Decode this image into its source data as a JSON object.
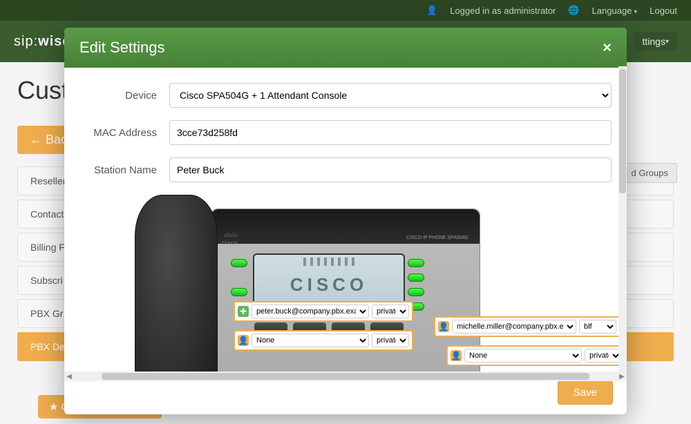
{
  "topbar": {
    "logged_in": "Logged in as administrator",
    "language": "Language",
    "logout": "Logout"
  },
  "nav": {
    "logo_left": "sip",
    "logo_right": "wise",
    "settings_menu": "ttings"
  },
  "page": {
    "title_truncated": "Cust",
    "back": "Back",
    "right_pill": "d Groups",
    "create_btn": "Create PBX Device"
  },
  "sidebar": {
    "items": [
      {
        "label": "Reseller"
      },
      {
        "label": "Contact"
      },
      {
        "label": "Billing F"
      },
      {
        "label": "Subscri"
      },
      {
        "label": "PBX Gr"
      },
      {
        "label": "PBX De"
      }
    ]
  },
  "modal": {
    "title": "Edit Settings",
    "save": "Save",
    "fields": {
      "device_label": "Device",
      "device_value": "Cisco SPA504G + 1 Attendant Console",
      "mac_label": "MAC Address",
      "mac_value": "3cce73d258fd",
      "station_label": "Station Name",
      "station_value": "Peter Buck"
    },
    "phone": {
      "brand_small": "cisco",
      "brand_bars": "ıılıılıı",
      "top_right": "CISCO IP PHONE\nSPA504G",
      "screen_text": "CISCO"
    },
    "linekeys": [
      {
        "icon": "plus",
        "subscriber": "peter.buck@company.pbx.examp",
        "mode": "private"
      },
      {
        "icon": "person",
        "subscriber": "None",
        "mode": "private"
      },
      {
        "icon": "person",
        "subscriber": "michelle.miller@company.pbx.ex",
        "mode": "blf"
      },
      {
        "icon": "person",
        "subscriber": "None",
        "mode": "private"
      }
    ],
    "mode_options": [
      "private",
      "blf"
    ]
  }
}
